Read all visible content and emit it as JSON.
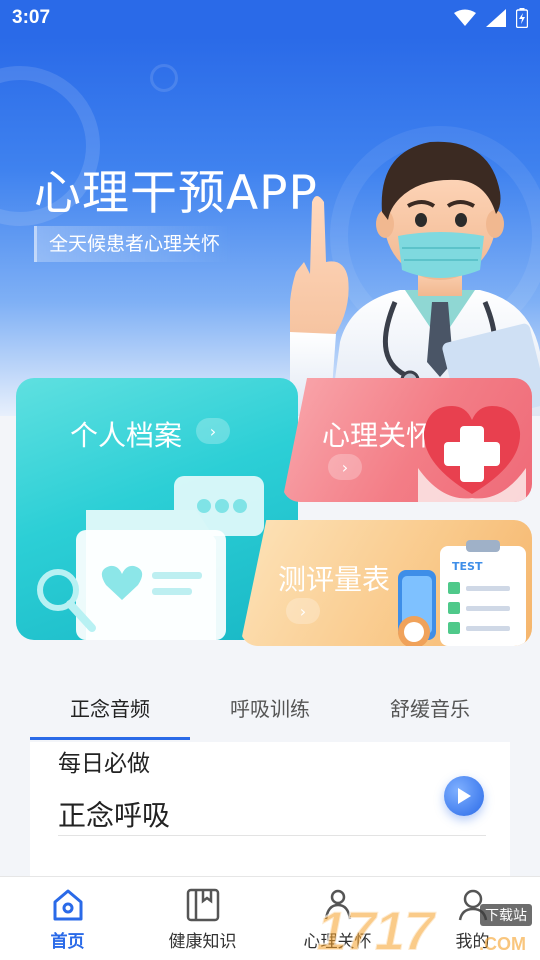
{
  "status_bar": {
    "time": "3:07"
  },
  "hero": {
    "title": "心理干预APP",
    "subtitle": "全天候患者心理关怀"
  },
  "cards": {
    "archive": {
      "title": "个人档案"
    },
    "care": {
      "title": "心理关怀"
    },
    "scale": {
      "title": "测评量表",
      "badge": "TEST"
    }
  },
  "tabs": [
    {
      "label": "正念音频",
      "active": true
    },
    {
      "label": "呼吸训练",
      "active": false
    },
    {
      "label": "舒缓音乐",
      "active": false
    }
  ],
  "panel": {
    "heading": "每日必做",
    "items": [
      {
        "title": "正念呼吸"
      }
    ]
  },
  "bottom_nav": [
    {
      "label": "首页",
      "icon": "home-icon",
      "active": true
    },
    {
      "label": "健康知识",
      "icon": "book-icon",
      "active": false
    },
    {
      "label": "心理关怀",
      "icon": "care-icon",
      "active": false
    },
    {
      "label": "我的",
      "icon": "profile-icon",
      "active": false
    }
  ],
  "watermark": {
    "number": "1717",
    "tag": "下载站",
    "suffix": ".COM"
  },
  "colors": {
    "primary": "#2a6ae8",
    "teal": "#2ccfd6",
    "pink": "#f37d86",
    "orange": "#f9c98a"
  }
}
